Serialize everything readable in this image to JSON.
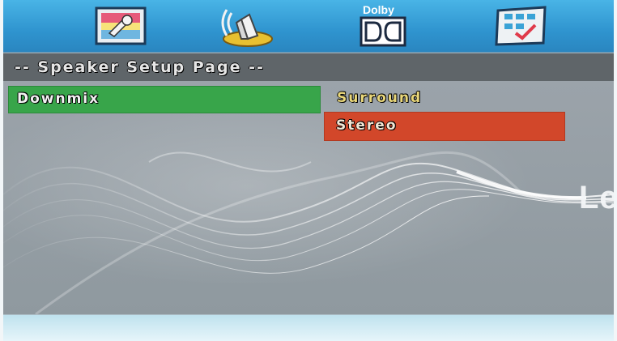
{
  "menu_bar": {
    "tabs": [
      {
        "icon": "general-setup-icon"
      },
      {
        "icon": "speaker-setup-icon"
      },
      {
        "icon": "dolby-digital-icon",
        "label": "Dolby"
      },
      {
        "icon": "preference-checklist-icon"
      }
    ]
  },
  "page": {
    "title": "-- Speaker Setup Page --"
  },
  "settings": {
    "items": [
      {
        "label": "Downmix",
        "selected": true
      }
    ],
    "options": [
      {
        "label": "Surround",
        "highlighted": false
      },
      {
        "label": "Stereo",
        "highlighted": true
      }
    ]
  },
  "background": {
    "brand_text": "Le"
  },
  "colors": {
    "menu_bar": "#2f94cf",
    "title_bar": "#5f6569",
    "selected_item": "#38a54a",
    "highlighted_option": "#d2472a",
    "option_text": "#e9d77a"
  }
}
